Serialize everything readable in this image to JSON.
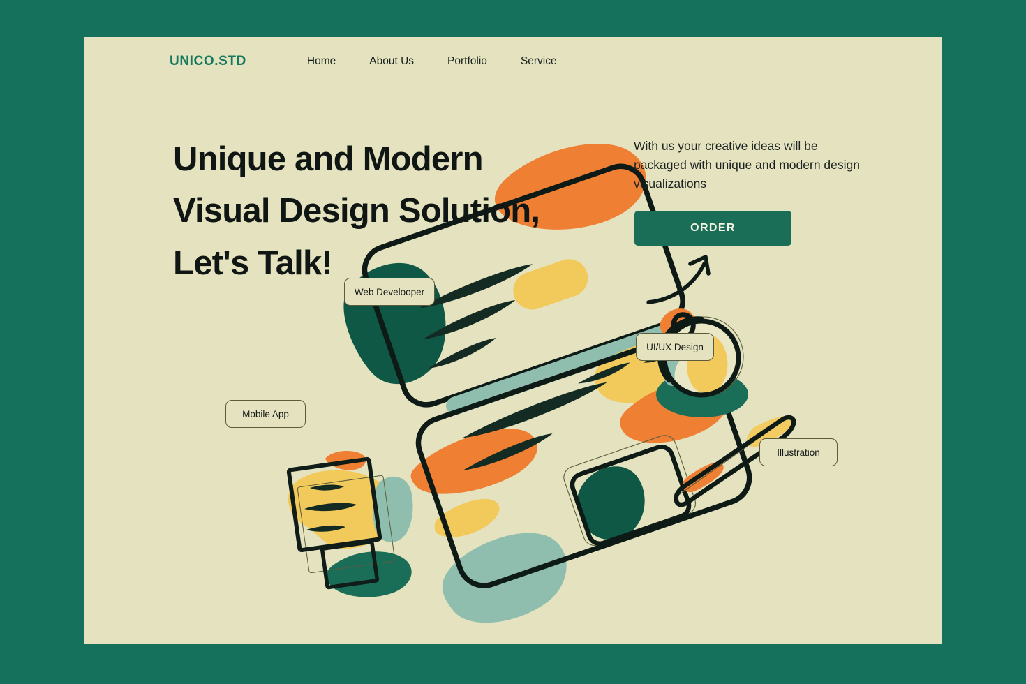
{
  "theme": {
    "frame_green": "#15705c",
    "card_cream": "#e5e2bf",
    "accent_green": "#1a6e57",
    "dark_green": "#0f5846",
    "orange": "#ef7f33",
    "yellow": "#f2ca5c",
    "teal": "#8fbdae",
    "ink": "#101614"
  },
  "navbar": {
    "logo": "UNICO.STD",
    "links": [
      {
        "label": "Home"
      },
      {
        "label": "About Us"
      },
      {
        "label": "Portfolio"
      },
      {
        "label": "Service"
      }
    ]
  },
  "hero": {
    "headline_lines": [
      "Unique and Modern",
      "Visual Design Solution,",
      "Let's Talk!"
    ],
    "subtext": "With us your creative ideas will be packaged with unique and modern design visualizations",
    "cta_label": "ORDER",
    "arrow_icon": "curved-arrow-up-right-icon"
  },
  "illustration": {
    "alt": "flat-illustration-desk-laptop-tablet-coffee-pen",
    "tags": [
      {
        "label": "Web Develooper"
      },
      {
        "label": "Mobile App"
      },
      {
        "label": "UI/UX Design"
      },
      {
        "label": "Illustration"
      }
    ]
  }
}
